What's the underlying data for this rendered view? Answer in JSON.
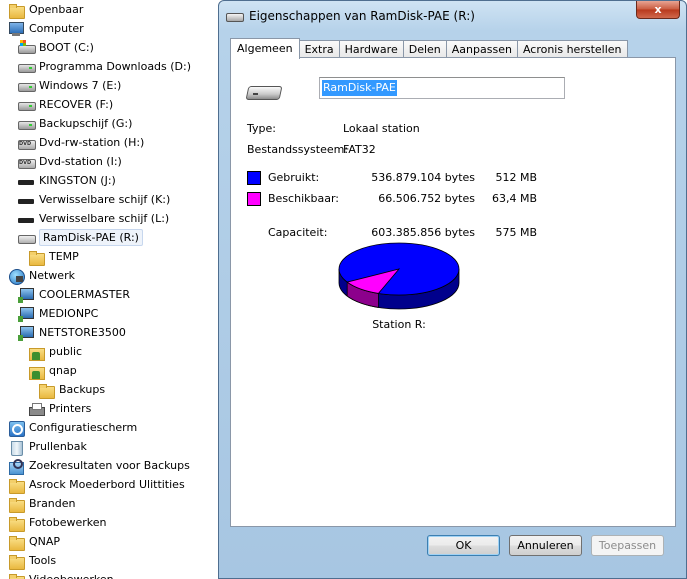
{
  "tree": {
    "items": [
      {
        "label": "Openbaar",
        "icon": "folder-icon"
      },
      {
        "label": "Computer",
        "icon": "computer-icon"
      },
      {
        "label": "BOOT (C:)",
        "icon": "windows-drive-icon"
      },
      {
        "label": "Programma Downloads (D:)",
        "icon": "drive-icon"
      },
      {
        "label": "Windows 7 (E:)",
        "icon": "drive-icon"
      },
      {
        "label": "RECOVER (F:)",
        "icon": "drive-icon"
      },
      {
        "label": "Backupschijf (G:)",
        "icon": "drive-icon"
      },
      {
        "label": "Dvd-rw-station (H:)",
        "icon": "dvd-drive-icon"
      },
      {
        "label": "Dvd-station (I:)",
        "icon": "dvd-drive-icon"
      },
      {
        "label": "KINGSTON (J:)",
        "icon": "usb-drive-icon"
      },
      {
        "label": "Verwisselbare schijf (K:)",
        "icon": "usb-drive-icon"
      },
      {
        "label": "Verwisselbare schijf (L:)",
        "icon": "usb-drive-icon"
      },
      {
        "label": "RamDisk-PAE (R:)",
        "icon": "drive-icon"
      },
      {
        "label": "TEMP",
        "icon": "folder-icon"
      },
      {
        "label": "Netwerk",
        "icon": "network-icon"
      },
      {
        "label": "COOLERMASTER",
        "icon": "network-computer-icon"
      },
      {
        "label": "MEDIONPC",
        "icon": "network-computer-icon"
      },
      {
        "label": "NETSTORE3500",
        "icon": "network-computer-icon"
      },
      {
        "label": "public",
        "icon": "shared-folder-icon"
      },
      {
        "label": "qnap",
        "icon": "shared-folder-icon"
      },
      {
        "label": "Backups",
        "icon": "folder-icon"
      },
      {
        "label": "Printers",
        "icon": "printer-icon"
      },
      {
        "label": "Configuratiescherm",
        "icon": "control-panel-icon"
      },
      {
        "label": "Prullenbak",
        "icon": "recycle-bin-icon"
      },
      {
        "label": "Zoekresultaten voor Backups",
        "icon": "search-folder-icon"
      },
      {
        "label": "Asrock Moederbord Ulittities",
        "icon": "folder-icon"
      },
      {
        "label": "Branden",
        "icon": "folder-icon"
      },
      {
        "label": "Fotobewerken",
        "icon": "folder-icon"
      },
      {
        "label": "QNAP",
        "icon": "folder-icon"
      },
      {
        "label": "Tools",
        "icon": "folder-icon"
      },
      {
        "label": "Videobewerken",
        "icon": "folder-icon"
      }
    ]
  },
  "dialog": {
    "title": "Eigenschappen van RamDisk-PAE (R:)",
    "close_label": "x",
    "tabs": [
      "Algemeen",
      "Extra",
      "Hardware",
      "Delen",
      "Aanpassen",
      "Acronis herstellen"
    ],
    "volume_name": "RamDisk-PAE",
    "type_label": "Type:",
    "type_value": "Lokaal station",
    "fs_label": "Bestandssysteem:",
    "fs_value": "FAT32",
    "used_label": "Gebruikt:",
    "used_bytes": "536.879.104 bytes",
    "used_size": "512 MB",
    "free_label": "Beschikbaar:",
    "free_bytes": "66.506.752 bytes",
    "free_size": "63,4 MB",
    "capacity_label": "Capaciteit:",
    "capacity_bytes": "603.385.856 bytes",
    "capacity_size": "575 MB",
    "station_caption": "Station R:",
    "used_color": "#0000ff",
    "free_color": "#ff00ff",
    "used_fraction": 0.8898,
    "ok_label": "OK",
    "cancel_label": "Annuleren",
    "apply_label": "Toepassen"
  }
}
